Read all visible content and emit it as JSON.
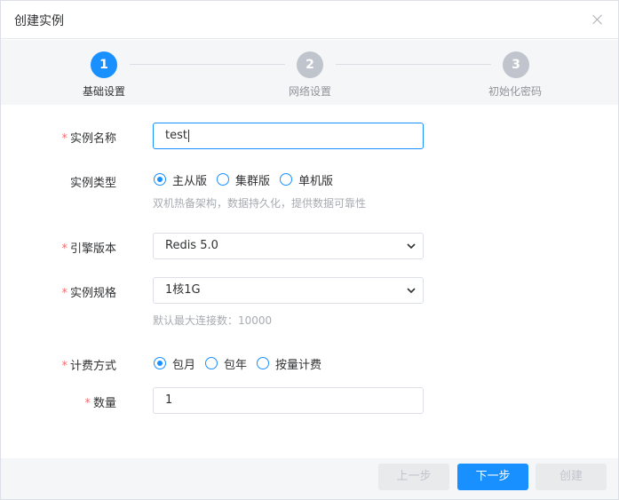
{
  "dialog": {
    "title": "创建实例"
  },
  "steps": [
    {
      "number": "1",
      "label": "基础设置"
    },
    {
      "number": "2",
      "label": "网络设置"
    },
    {
      "number": "3",
      "label": "初始化密码"
    }
  ],
  "form": {
    "required_mark": "*",
    "name": {
      "label": "实例名称",
      "value": "test"
    },
    "type": {
      "label": "实例类型",
      "options": [
        "主从版",
        "集群版",
        "单机版"
      ],
      "selected": "主从版",
      "hint": "双机热备架构，数据持久化，提供数据可靠性"
    },
    "engine": {
      "label": "引擎版本",
      "value": "Redis 5.0"
    },
    "spec": {
      "label": "实例规格",
      "value": "1核1G",
      "hint": "默认最大连接数：10000"
    },
    "billing": {
      "label": "计费方式",
      "options": [
        "包月",
        "包年",
        "按量计费"
      ],
      "selected": "包月"
    },
    "quantity": {
      "label": "数量",
      "value": "1"
    }
  },
  "footer": {
    "prev_label": "上一步",
    "next_label": "下一步",
    "create_label": "创建"
  },
  "colors": {
    "primary": "#1890ff",
    "required": "#f56c6c"
  }
}
